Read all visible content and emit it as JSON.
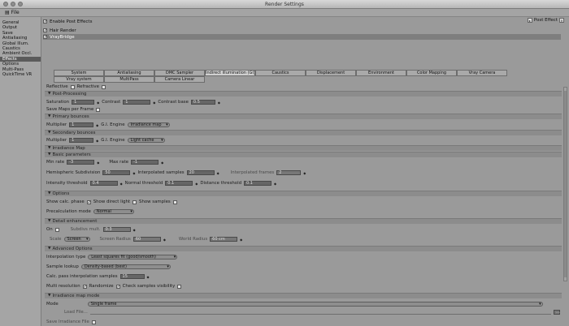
{
  "window": {
    "title": "Render Settings"
  },
  "menu": {
    "file": "File"
  },
  "sidebar": {
    "items": [
      {
        "label": "General"
      },
      {
        "label": "Output"
      },
      {
        "label": "Save"
      },
      {
        "label": "Antialiasing"
      },
      {
        "label": "Global Illum."
      },
      {
        "label": "Caustics"
      },
      {
        "label": "Ambient Occl."
      },
      {
        "label": "Effects"
      },
      {
        "label": "Options"
      },
      {
        "label": "Multi-Pass"
      },
      {
        "label": "QuickTime VR"
      }
    ],
    "selected": "Effects"
  },
  "effects": {
    "enable_post": "Enable Post Effects",
    "post_effect_btn": "Post Effect",
    "list": [
      {
        "label": "Hair Render"
      },
      {
        "label": "VrayBridge"
      }
    ]
  },
  "tabs": {
    "row1": [
      "System",
      "Antialiasing",
      "DMC Sampler",
      "Indirect illumination (GI)",
      "Caustics",
      "Displacement",
      "Environment",
      "Color Mapping",
      "Vray Camera"
    ],
    "row2": [
      "Vray system",
      "MultiPass",
      "Camera Linear"
    ],
    "active": "Indirect illumination (GI)"
  },
  "gi": {
    "reflective": "Reflective",
    "refractive": "Refractive",
    "post_processing": "Post-Processing",
    "saturation": "Saturation",
    "saturation_val": "1",
    "contrast": "Contrast",
    "contrast_val": "1",
    "contrast_base": "Contrast base",
    "contrast_base_val": "0.5",
    "save_maps": "Save Maps per Frame",
    "primary_bounces": "Primary bounces",
    "multiplier": "Multiplier",
    "primary_mult": "1",
    "gi_engine": "G.I. Engine",
    "primary_engine": "Irradiance map",
    "secondary_bounces": "Secondary bounces",
    "secondary_mult": "1",
    "secondary_engine": "Light cache",
    "irradiance_map": "Irradiance Map",
    "basic_params": "Basic parameters",
    "min_rate": "Min rate",
    "min_rate_val": "-3",
    "max_rate": "Max rate",
    "max_rate_val": "-1",
    "hsph": "Hemispheric Subdivision",
    "hsph_val": "50",
    "interp_samples": "Interpolated samples",
    "interp_samples_val": "20",
    "interp_frames": "Interpolated frames",
    "interp_frames_val": "2",
    "intensity_thresh": "Intensity threshold",
    "intensity_thresh_val": "0.4",
    "normal_thresh": "Normal threshold",
    "normal_thresh_val": "0.1",
    "distance_thresh": "Distance threshold",
    "distance_thresh_val": "0.1",
    "options": "Options",
    "show_calc": "Show calc. phase",
    "show_direct": "Show direct light",
    "show_samples": "Show samples",
    "precalc_mode": "Precalculation mode",
    "precalc_mode_val": "Normal",
    "detail_enh": "Detail enhancement",
    "on": "On",
    "subdivs_mult": "Subdivs mult.",
    "subdivs_mult_val": "0.3",
    "scale": "Scale",
    "scale_val": "Screen",
    "screen_radius": "Screen Radius",
    "screen_radius_val": "60",
    "world_radius": "World Radius",
    "world_radius_val": "60 cm",
    "advanced": "Advanced Options",
    "interp_type": "Interpolation type",
    "interp_type_val": "Least squares fit (good/smooth)",
    "sample_lookup": "Sample lookup",
    "sample_lookup_val": "Density-based (best)",
    "calc_pass": "Calc. pass interpolation samples",
    "calc_pass_val": "15",
    "multi_res": "Multi resolution",
    "randomize": "Randomize",
    "check_vis": "Check samples visibility",
    "map_mode": "Irradiance map mode",
    "mode": "Mode",
    "mode_val": "Single frame",
    "load_file": "Load File...",
    "save_file": "Save Irradiance File"
  }
}
